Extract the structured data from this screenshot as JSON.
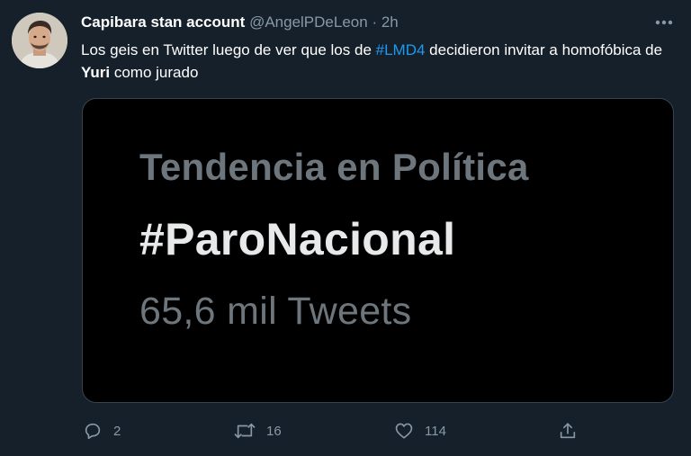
{
  "tweet": {
    "author": {
      "display_name": "Capibara stan account",
      "handle": "@AngelPDeLeon",
      "separator": "·",
      "time": "2h"
    },
    "text": {
      "part1": "Los geis en Twitter luego de ver que los de ",
      "hashtag": "#LMD4",
      "part2": " decidieron invitar a homofóbica de ",
      "bold_word": "Yuri",
      "part3": " como jurado"
    },
    "media": {
      "line1": "Tendencia en Política",
      "line2": "#ParoNacional",
      "line3": "65,6 mil Tweets"
    },
    "actions": {
      "reply_count": "2",
      "retweet_count": "16",
      "like_count": "114"
    },
    "icons": {
      "more": "more-dots-icon",
      "reply": "reply-icon",
      "retweet": "retweet-icon",
      "like": "heart-icon",
      "share": "share-icon"
    },
    "colors": {
      "background": "#15202b",
      "link": "#1d9bf0",
      "secondary_text": "#8899a6"
    }
  }
}
